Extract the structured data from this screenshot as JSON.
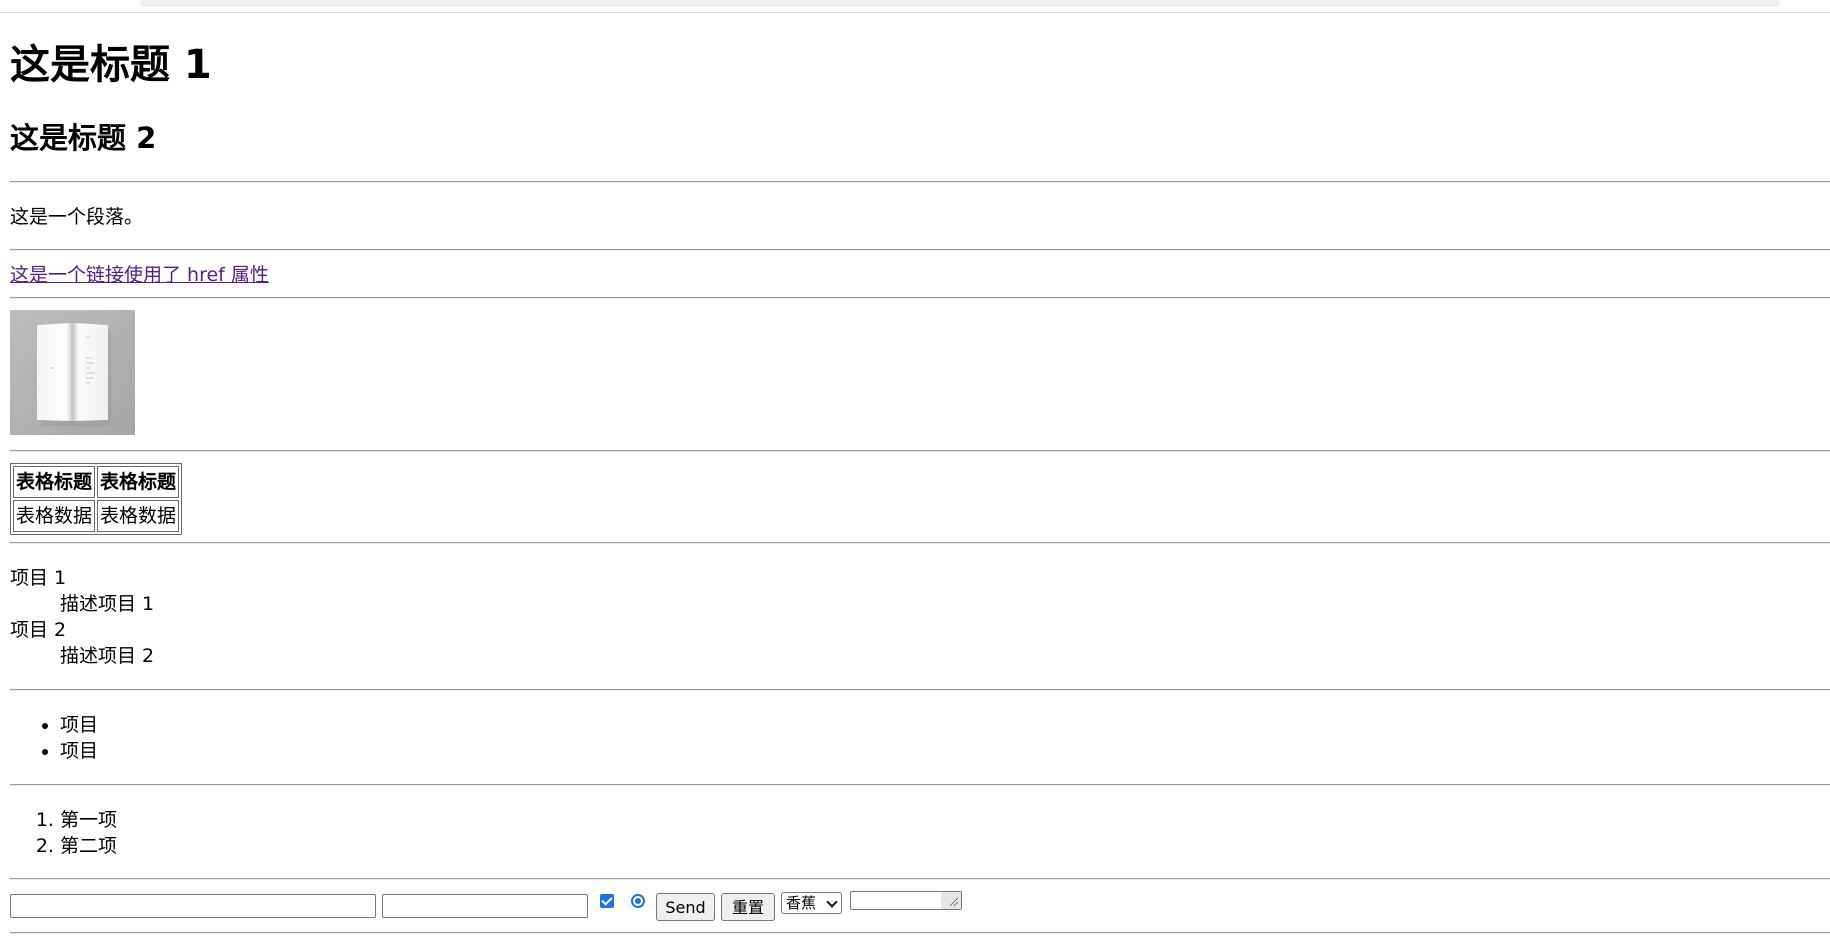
{
  "headings": {
    "h1": "这是标题 1",
    "h2": "这是标题 2"
  },
  "paragraph": "这是一个段落。",
  "link": {
    "text": "这是一个链接使用了 href 属性",
    "color": "#551a8b"
  },
  "image": {
    "icon": "open-book-image"
  },
  "table": {
    "headers": [
      "表格标题",
      "表格标题"
    ],
    "rows": [
      [
        "表格数据",
        "表格数据"
      ]
    ]
  },
  "definition_list": [
    {
      "term": "项目 1",
      "description": "描述项目 1"
    },
    {
      "term": "项目 2",
      "description": "描述项目 2"
    }
  ],
  "unordered_list": [
    "项目",
    "项目"
  ],
  "ordered_list": [
    "第一项",
    "第二项"
  ],
  "form": {
    "text_input_value": "",
    "password_input_value": "",
    "checkbox_checked": true,
    "radio_checked": true,
    "submit_label": "Send",
    "reset_label": "重置",
    "select_value": "香蕉",
    "textarea_value": "",
    "accent_color": "#1a73e8"
  }
}
